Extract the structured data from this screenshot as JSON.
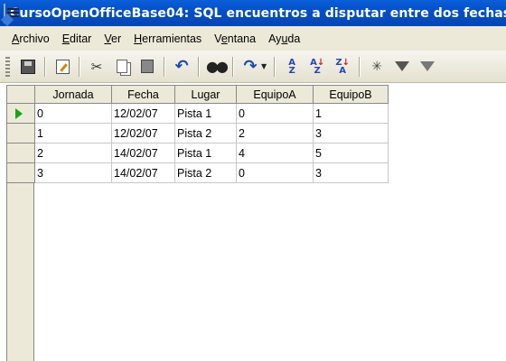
{
  "window": {
    "title": "CursoOpenOfficeBase04: SQL encuentros a disputar entre dos fechas"
  },
  "menu": {
    "items": [
      {
        "label": "Archivo",
        "accel": "A",
        "rest": "rchivo"
      },
      {
        "label": "Editar",
        "accel": "E",
        "rest": "ditar"
      },
      {
        "label": "Ver",
        "accel": "V",
        "rest": "er"
      },
      {
        "label": "Herramientas",
        "accel": "H",
        "rest": "erramientas"
      },
      {
        "label": "Ventana",
        "pre": "V",
        "accel": "e",
        "rest": "ntana"
      },
      {
        "label": "Ayuda",
        "pre": "Ay",
        "accel": "u",
        "rest": "da"
      }
    ]
  },
  "toolbar": {
    "icons": [
      "save-icon",
      "edit-icon",
      "cut-icon",
      "copy-icon",
      "paste-icon",
      "undo-icon",
      "find-icon",
      "redo-icon",
      "sort-ascending-icon",
      "sort-ascending-red-icon",
      "sort-descending-icon",
      "autofilter-icon",
      "standard-filter-icon",
      "remove-filter-icon"
    ]
  },
  "table": {
    "columns": [
      "Jornada",
      "Fecha",
      "Lugar",
      "EquipoA",
      "EquipoB"
    ],
    "rows": [
      [
        "0",
        "12/02/07",
        "Pista 1",
        "0",
        "1"
      ],
      [
        "1",
        "12/02/07",
        "Pista 2",
        "2",
        "3"
      ],
      [
        "2",
        "14/02/07",
        "Pista 1",
        "4",
        "5"
      ],
      [
        "3",
        "14/02/07",
        "Pista 2",
        "0",
        "3"
      ]
    ],
    "current_row": 0
  },
  "colors": {
    "titlebar": "#0550c8",
    "chrome": "#ece9d8",
    "current_row_marker": "#1aa31a"
  }
}
